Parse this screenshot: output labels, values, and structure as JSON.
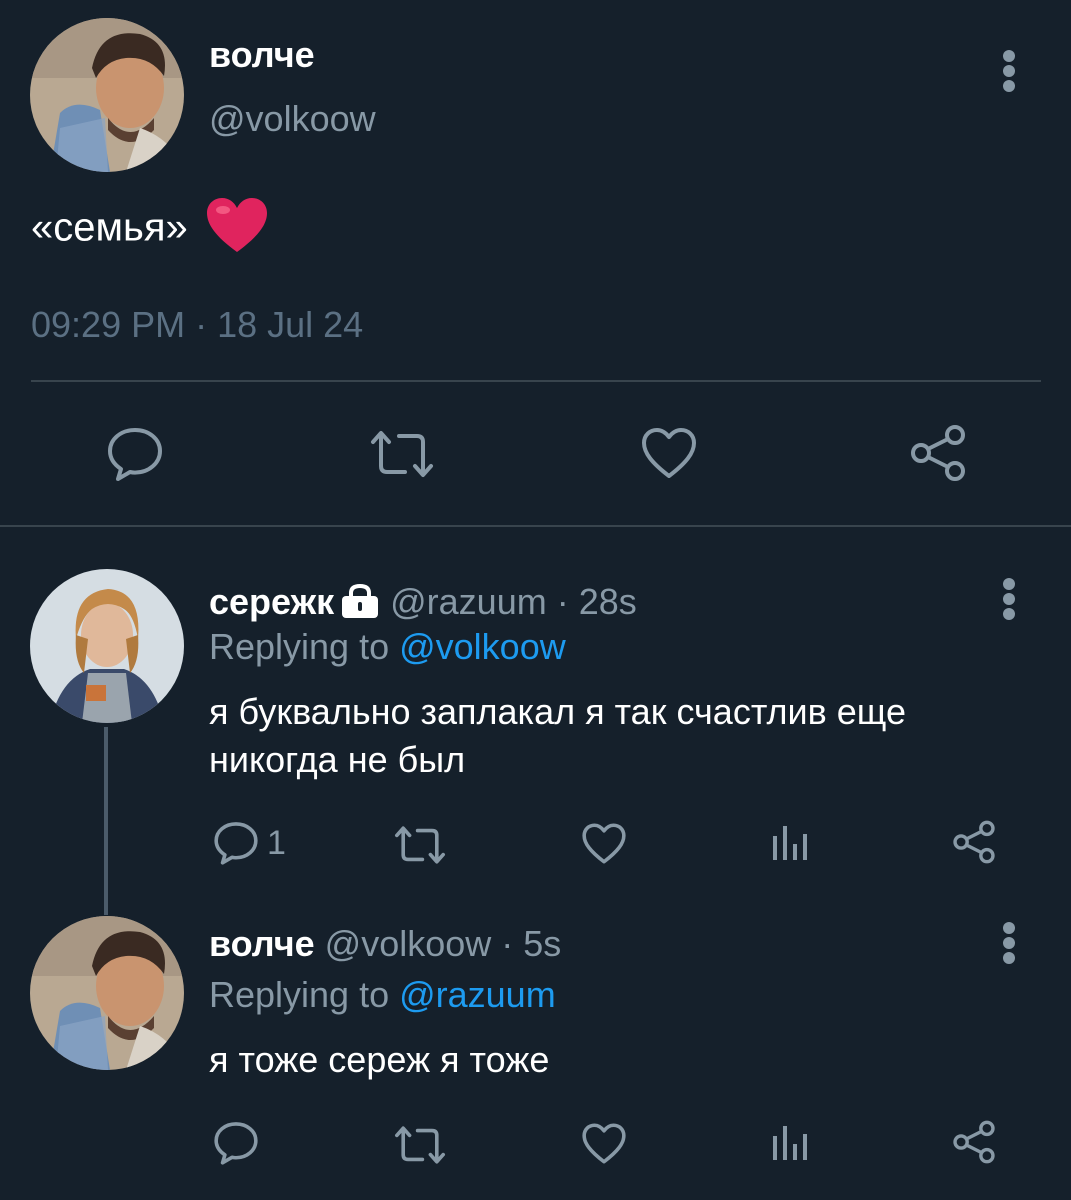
{
  "main_tweet": {
    "name": "волче",
    "handle": "@volkoow",
    "text": "«семья»",
    "emoji": "heart-emoji",
    "timestamp": "09:29 PM · 18 Jul 24",
    "actions": [
      "reply-icon",
      "retweet-icon",
      "like-icon",
      "share-icon"
    ]
  },
  "replies": [
    {
      "name": "сережк",
      "protected": true,
      "handle_time": "@razuum · 28s",
      "replying_prefix": "Replying to ",
      "replying_to": "@volkoow",
      "text_line1": "я буквально заплакал я так счастлив еще",
      "text_line2": "никогда не был",
      "reply_count": "1"
    },
    {
      "name": "волче",
      "protected": false,
      "handle_time": "@volkoow · 5s",
      "replying_prefix": "Replying to ",
      "replying_to": "@razuum",
      "text_line1": "я тоже сереж я тоже",
      "reply_count": ""
    }
  ],
  "colors": {
    "background": "#15202b",
    "text_primary": "#ffffff",
    "text_secondary": "#8899a6",
    "accent": "#1d9bf0",
    "divider": "#38444d",
    "heart": "#e0245e"
  }
}
